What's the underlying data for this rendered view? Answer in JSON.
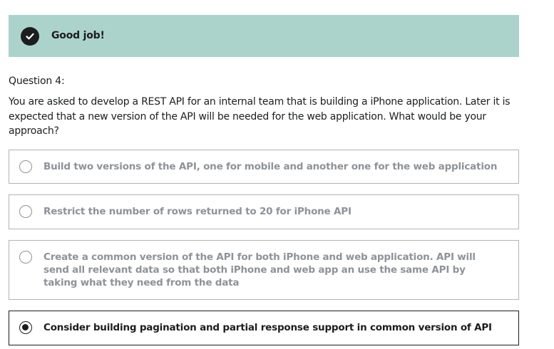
{
  "feedback": {
    "title": "Good job!",
    "icon": "check-circle-icon",
    "background": "#acd2cc"
  },
  "question": {
    "number_label": "Question 4:",
    "text": "You are asked to develop a REST API for an internal team that is building a iPhone application. Later it is expected that a new version of the API will be needed for the web application. What would be your approach?"
  },
  "options": [
    {
      "label": "Build two versions of the API, one for mobile and another one for the web application",
      "selected": false
    },
    {
      "label": "Restrict the number of rows returned to 20 for iPhone API",
      "selected": false
    },
    {
      "label": "Create a common version of the API for both iPhone and web application. API will send all relevant data so that both iPhone and web app an use the same API by taking what they need from the data",
      "selected": false
    },
    {
      "label": "Consider building pagination and partial response support in common version of API",
      "selected": true
    }
  ]
}
